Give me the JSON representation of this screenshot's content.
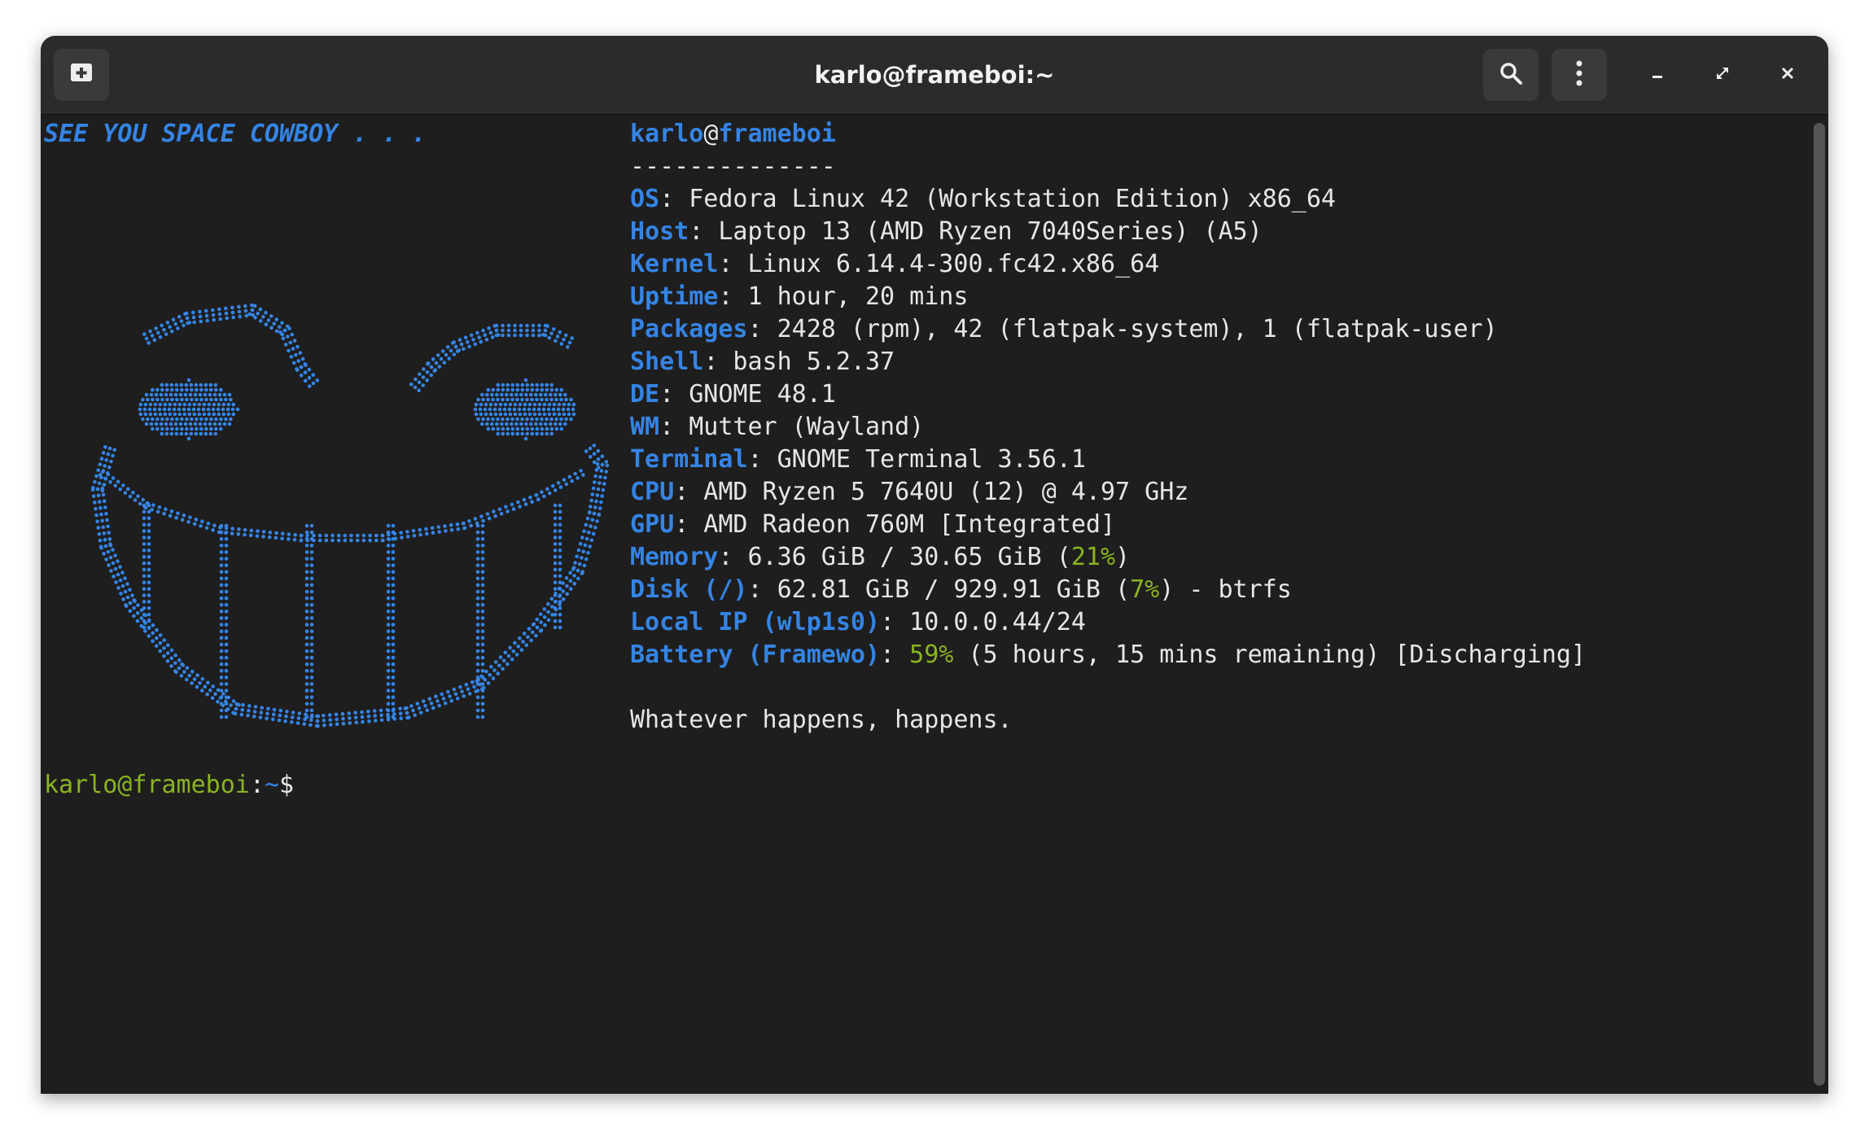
{
  "window": {
    "title": "karlo@frameboi:~",
    "icons": {
      "new_tab": "new-tab-icon",
      "search": "search-icon",
      "menu": "kebab-menu-icon",
      "minimize": "minimize-icon",
      "maximize": "maximize-icon",
      "close": "close-icon"
    }
  },
  "ascii": {
    "slogan": "SEE YOU SPACE COWBOY . . ."
  },
  "info": {
    "user": "karlo",
    "at": "@",
    "host": "frameboi",
    "separator": "--------------",
    "rows": [
      {
        "key": "OS",
        "value": ": Fedora Linux 42 (Workstation Edition) x86_64"
      },
      {
        "key": "Host",
        "value": ": Laptop 13 (AMD Ryzen 7040Series) (A5)"
      },
      {
        "key": "Kernel",
        "value": ": Linux 6.14.4-300.fc42.x86_64"
      },
      {
        "key": "Uptime",
        "value": ": 1 hour, 20 mins"
      },
      {
        "key": "Packages",
        "value": ": 2428 (rpm), 42 (flatpak-system), 1 (flatpak-user)"
      },
      {
        "key": "Shell",
        "value": ": bash 5.2.37"
      },
      {
        "key": "DE",
        "value": ": GNOME 48.1"
      },
      {
        "key": "WM",
        "value": ": Mutter (Wayland)"
      },
      {
        "key": "Terminal",
        "value": ": GNOME Terminal 3.56.1"
      },
      {
        "key": "CPU",
        "value": ": AMD Ryzen 5 7640U (12) @ 4.97 GHz"
      },
      {
        "key": "GPU",
        "value": ": AMD Radeon 760M [Integrated]"
      }
    ],
    "memory": {
      "key": "Memory",
      "pre": ": 6.36 GiB / 30.65 GiB (",
      "pct": "21%",
      "post": ")"
    },
    "disk": {
      "key": "Disk (/)",
      "pre": ": 62.81 GiB / 929.91 GiB (",
      "pct": "7%",
      "post": ") - btrfs"
    },
    "localip": {
      "key": "Local IP (wlp1s0)",
      "value": ": 10.0.0.44/24"
    },
    "battery": {
      "key": "Battery (Framewo)",
      "pre": ": ",
      "pct": "59%",
      "post": " (5 hours, 15 mins remaining) [Discharging]"
    },
    "quote": "Whatever happens, happens."
  },
  "prompt": {
    "userhost": "karlo@frameboi",
    "colon": ":",
    "path": "~",
    "symbol": "$"
  },
  "colors": {
    "accent": "#3584e4",
    "green": "#8ab421",
    "bg": "#1e1e1e",
    "text": "#e6e6e6"
  }
}
